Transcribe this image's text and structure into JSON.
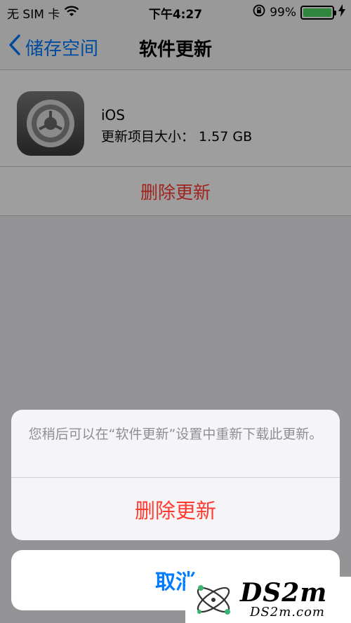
{
  "status_bar": {
    "carrier": "无 SIM 卡",
    "time": "下午4:27",
    "battery_percent_text": "99%",
    "battery_level": 0.99
  },
  "nav": {
    "back_label": "储存空间",
    "title": "软件更新"
  },
  "update": {
    "app_name": "iOS",
    "size_label": "更新项目大小： 1.57 GB",
    "delete_label": "删除更新"
  },
  "action_sheet": {
    "message": "您稍后可以在“软件更新”设置中重新下载此更新。",
    "delete_label": "删除更新",
    "cancel_label": "取消"
  },
  "watermark": {
    "brand": "DS2m",
    "url": "DS2m.com"
  },
  "colors": {
    "accent": "#007aff",
    "destructive": "#ff3b30",
    "battery": "#4cd964"
  }
}
